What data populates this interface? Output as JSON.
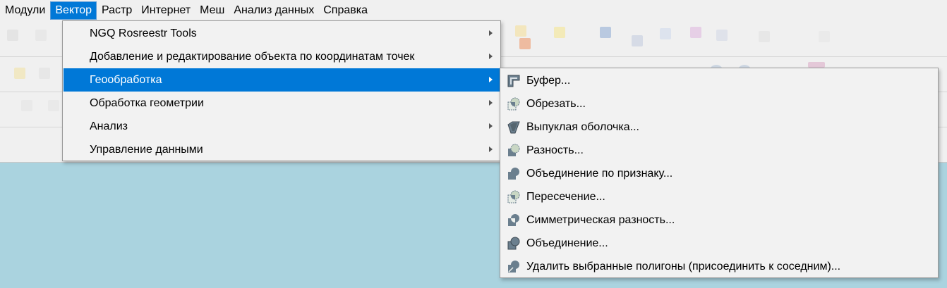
{
  "menubar": {
    "items": [
      "Модули",
      "Вектор",
      "Растр",
      "Интернет",
      "Меш",
      "Анализ данных",
      "Справка"
    ],
    "active_index": 1
  },
  "vector_menu": {
    "items": [
      {
        "label": "NGQ Rosreestr Tools",
        "has_submenu": true
      },
      {
        "label": "Добавление и редактирование объекта по координатам точек",
        "has_submenu": true
      },
      {
        "label": "Геообработка",
        "has_submenu": true,
        "highlighted": true
      },
      {
        "label": "Обработка геометрии",
        "has_submenu": true
      },
      {
        "label": "Анализ",
        "has_submenu": true
      },
      {
        "label": "Управление данными",
        "has_submenu": true
      }
    ]
  },
  "geoprocessing_menu": {
    "items": [
      {
        "label": "Буфер...",
        "icon": "buffer-icon"
      },
      {
        "label": "Обрезать...",
        "icon": "clip-icon"
      },
      {
        "label": "Выпуклая оболочка...",
        "icon": "convex-hull-icon"
      },
      {
        "label": "Разность...",
        "icon": "difference-icon"
      },
      {
        "label": "Объединение по признаку...",
        "icon": "dissolve-icon"
      },
      {
        "label": "Пересечение...",
        "icon": "intersection-icon"
      },
      {
        "label": "Симметрическая разность...",
        "icon": "symmetric-difference-icon"
      },
      {
        "label": "Объединение...",
        "icon": "union-icon"
      },
      {
        "label": "Удалить выбранные полигоны (присоединить к соседним)...",
        "icon": "eliminate-icon"
      }
    ]
  },
  "colors": {
    "menu_highlight": "#0078d7",
    "map_background": "#aad3df",
    "icon_fill": "#6b7f8e",
    "icon_light": "#c9d7c4"
  }
}
